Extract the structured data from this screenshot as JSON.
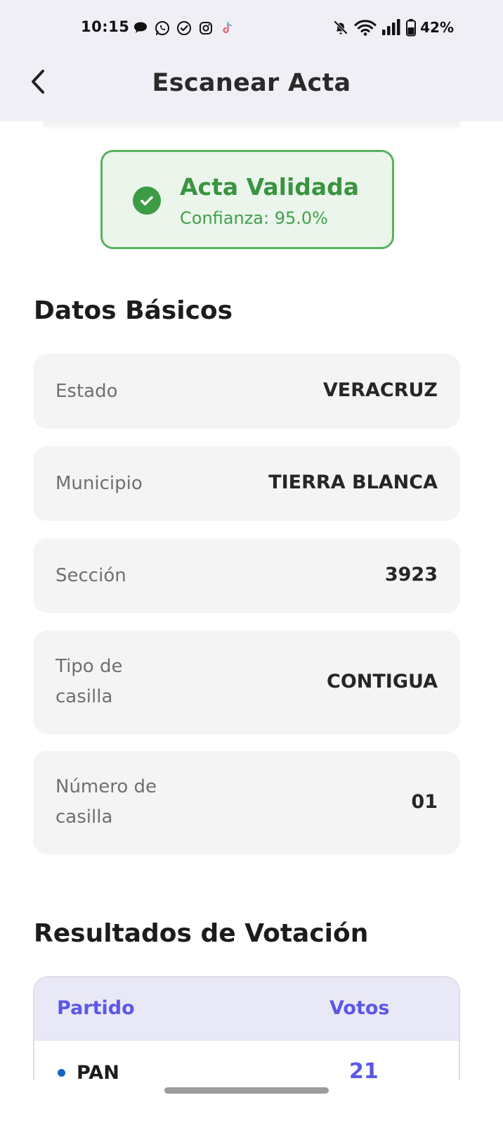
{
  "status_bar": {
    "time": "10:15",
    "battery": "42%",
    "notification_icons": [
      "chat-bubble-icon",
      "whatsapp-icon",
      "check-circle-icon",
      "instagram-icon",
      "tiktok-icon"
    ],
    "system_icons": [
      "bell-off-icon",
      "wifi-icon",
      "signal-icon",
      "battery-icon"
    ]
  },
  "app_bar": {
    "title": "Escanear Acta",
    "back_icon": "chevron-left-icon"
  },
  "validation": {
    "title": "Acta Validada",
    "confidence": "Confianza: 95.0%",
    "icon": "check-circle-icon",
    "color": "#3a9440"
  },
  "basic_data": {
    "title": "Datos Básicos",
    "fields": [
      {
        "label": "Estado",
        "value": "VERACRUZ"
      },
      {
        "label": "Municipio",
        "value": "TIERRA BLANCA"
      },
      {
        "label": "Sección",
        "value": "3923"
      },
      {
        "label": "Tipo de casilla",
        "value": "CONTIGUA"
      },
      {
        "label": "Número de casilla",
        "value": "01"
      }
    ]
  },
  "results": {
    "title": "Resultados de Votación",
    "columns": {
      "party": "Partido",
      "votes": "Votos"
    },
    "rows": [
      {
        "party": "PAN",
        "votes": "21",
        "dot_color": "#1565c0"
      }
    ],
    "accent_color": "#5b58e6"
  }
}
